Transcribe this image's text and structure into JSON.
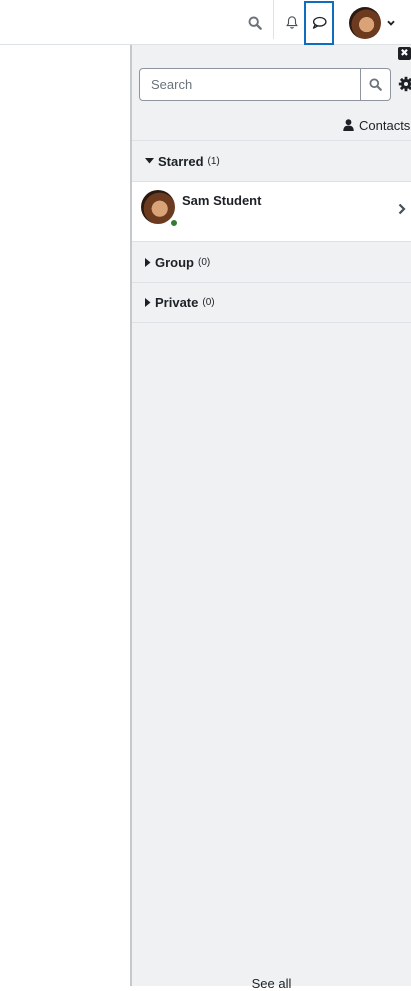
{
  "navbar": {
    "search_icon": "search-icon",
    "notifications_icon": "bell-icon",
    "messages_icon": "chat-bubble-icon",
    "user_menu_icon": "chevron-down-icon"
  },
  "drawer": {
    "close_icon": "close-icon",
    "search_placeholder": "Search",
    "settings_icon": "gear-icon",
    "contacts_label": "Contacts",
    "sections": {
      "starred": {
        "title": "Starred",
        "count": "(1)"
      },
      "group": {
        "title": "Group",
        "count": "(0)"
      },
      "private": {
        "title": "Private",
        "count": "(0)"
      }
    },
    "starred_contacts": [
      {
        "name": "Sam Student",
        "status": "online"
      }
    ],
    "see_all_label": "See all"
  },
  "colors": {
    "accent": "#0f6cbf",
    "online": "#357a32",
    "drawer_bg": "#eff1f3"
  }
}
